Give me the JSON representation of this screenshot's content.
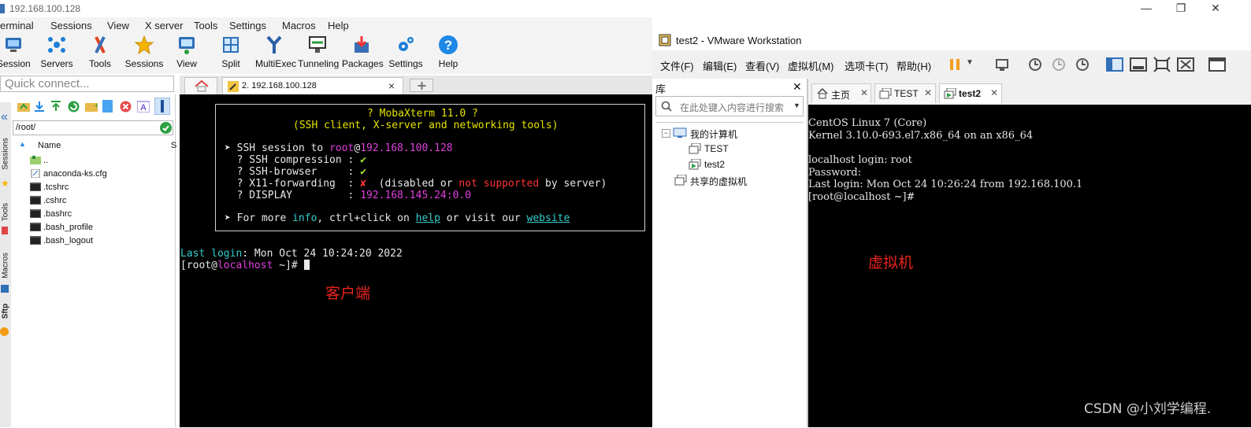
{
  "moba": {
    "title": "192.168.100.128",
    "menu": [
      "erminal",
      "Sessions",
      "View",
      "X server",
      "Tools",
      "Settings",
      "Macros",
      "Help"
    ],
    "toolbar": [
      {
        "label": "Session",
        "icon": "session-icon"
      },
      {
        "label": "Servers",
        "icon": "servers-icon"
      },
      {
        "label": "Tools",
        "icon": "tools-icon"
      },
      {
        "label": "Sessions",
        "icon": "sessions-star-icon"
      },
      {
        "label": "View",
        "icon": "view-icon"
      },
      {
        "label": "Split",
        "icon": "split-icon"
      },
      {
        "label": "MultiExec",
        "icon": "multiexec-icon"
      },
      {
        "label": "Tunneling",
        "icon": "tunneling-icon"
      },
      {
        "label": "Packages",
        "icon": "packages-icon"
      },
      {
        "label": "Settings",
        "icon": "settings-icon"
      },
      {
        "label": "Help",
        "icon": "help-icon"
      }
    ],
    "quick_connect_placeholder": "Quick connect...",
    "tab": {
      "label": "2. 192.168.100.128",
      "close": "×"
    },
    "side_tabs": [
      "Sessions",
      "Tools",
      "Macros",
      "Sftp"
    ],
    "sftp": {
      "path": "/root/",
      "column_name": "Name",
      "column_size": "S",
      "files": [
        {
          "name": "..",
          "type": "folder-up"
        },
        {
          "name": "anaconda-ks.cfg",
          "type": "file"
        },
        {
          "name": ".tcshrc",
          "type": "terminal-file"
        },
        {
          "name": ".cshrc",
          "type": "terminal-file"
        },
        {
          "name": ".bashrc",
          "type": "terminal-file"
        },
        {
          "name": ".bash_profile",
          "type": "terminal-file"
        },
        {
          "name": ".bash_logout",
          "type": "terminal-file"
        }
      ]
    },
    "terminal": {
      "header1": "? MobaXterm 11.0 ?",
      "header2": "(SSH client, X-server and networking tools)",
      "ssh_prefix": "➤ SSH session to ",
      "ssh_user": "root",
      "ssh_at": "@",
      "ssh_host": "192.168.100.128",
      "rows": [
        {
          "label": "  ? SSH compression : ",
          "value": "✔"
        },
        {
          "label": "  ? SSH-browser     : ",
          "value": "✔"
        }
      ],
      "x11_label": "  ? X11-forwarding  : ",
      "x11_mark": "✘",
      "x11_p1": "  (disabled or ",
      "x11_p2": "not supported",
      "x11_p3": " by server)",
      "display_label": "  ? DISPLAY         : ",
      "display_value": "192.168.145.24:0.0",
      "more_p1": "➤ For more ",
      "more_info": "info",
      "more_p2": ", ctrl+click on ",
      "more_help": "help",
      "more_p3": " or visit our ",
      "more_website": "website",
      "last_login_label": "Last login",
      "last_login_value": ": Mon Oct 24 10:24:20 2022",
      "prompt_open": "[root@",
      "prompt_host": "localhost",
      "prompt_close": " ~]# ",
      "annotation": "客户端"
    }
  },
  "vmware": {
    "title": "test2 - VMware Workstation",
    "menu": [
      "文件(F)",
      "编辑(E)",
      "查看(V)",
      "虚拟机(M)",
      "选项卡(T)",
      "帮助(H)"
    ],
    "library_title": "库",
    "search_placeholder": "在此处键入内容进行搜索",
    "tree": {
      "root": "我的计算机",
      "children": [
        "TEST",
        "test2"
      ],
      "shared": "共享的虚拟机"
    },
    "tabs": [
      {
        "label": "主页",
        "icon": "home-icon"
      },
      {
        "label": "TEST",
        "icon": "vm-icon"
      },
      {
        "label": "test2",
        "icon": "vm-running-icon",
        "active": true
      }
    ],
    "console": [
      "CentOS Linux 7 (Core)",
      "Kernel 3.10.0-693.el7.x86_64 on an x86_64",
      "",
      "localhost login: root",
      "Password:",
      "Last login: Mon Oct 24 10:26:24 from 192.168.100.1",
      "[root@localhost ~]#"
    ],
    "annotation": "虚拟机"
  },
  "watermark": "CSDN @小刘学编程.",
  "colors": {
    "terminal_bg": "#000000",
    "term_green": "#a6e22e",
    "term_yellow": "#e5e500",
    "term_magenta": "#e040e0",
    "term_cyan": "#33cccc",
    "term_red": "#ff3333",
    "annotation_red": "#e8231e"
  }
}
